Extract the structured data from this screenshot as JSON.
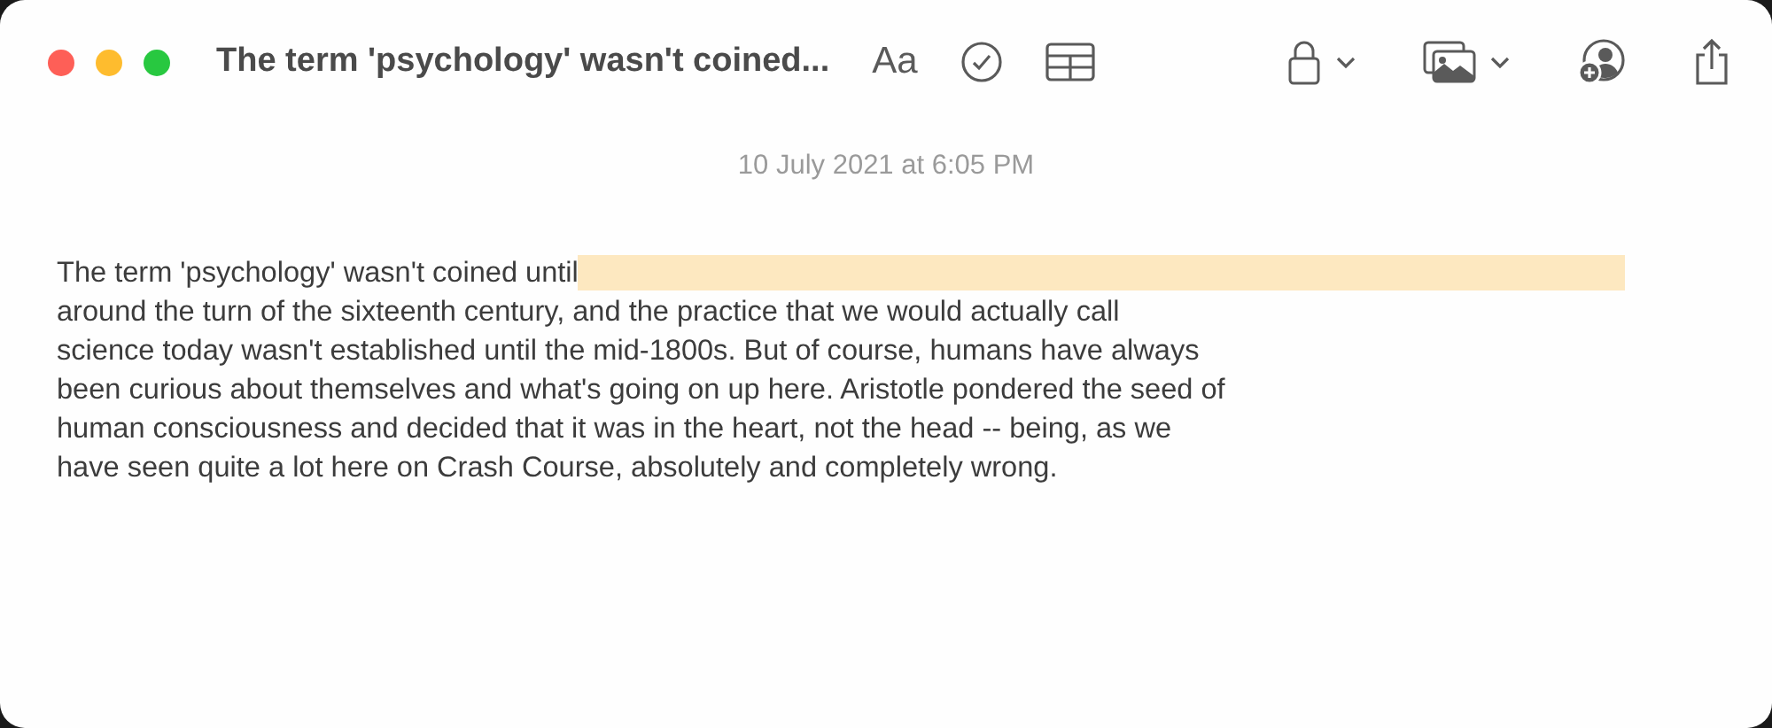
{
  "window": {
    "title": "The term 'psychology' wasn't coined..."
  },
  "toolbar": {
    "format_label": "Aa"
  },
  "note": {
    "date": "10 July 2021 at 6:05 PM",
    "lines": [
      {
        "text": "The term 'psychology' wasn't coined until",
        "highlighted_after": true
      },
      {
        "text": "around the turn of the sixteenth century, and the practice that we would actually call",
        "highlighted_after": false
      },
      {
        "text": "science today wasn't established until the mid-1800s. But of course, humans have always",
        "highlighted_after": false
      },
      {
        "text": "been curious about themselves and what's going on up here. Aristotle pondered the seed of",
        "highlighted_after": false
      },
      {
        "text": "human consciousness and decided that it was in the heart, not the head -- being, as we",
        "highlighted_after": false
      },
      {
        "text": "have seen quite a lot here on Crash Course, absolutely and completely wrong.",
        "highlighted_after": false
      }
    ]
  }
}
